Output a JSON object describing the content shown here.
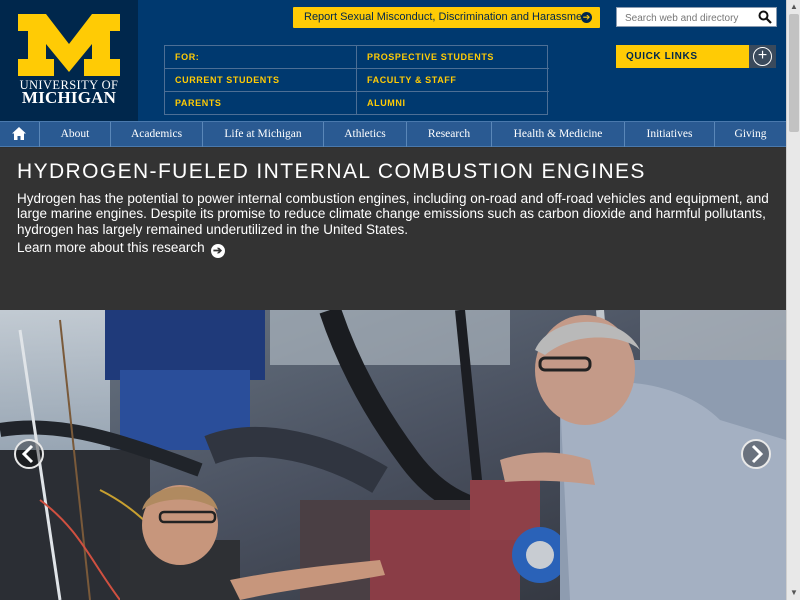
{
  "brand": {
    "line1": "UNIVERSITY OF",
    "line2": "MICHIGAN"
  },
  "alert": {
    "label": "Report Sexual Misconduct, Discrimination and Harassment",
    "icon": "arrow-right-circle-icon"
  },
  "search": {
    "placeholder": "Search web and directory",
    "icon": "search-icon"
  },
  "audiences": {
    "for_label": "FOR:",
    "items": [
      "PROSPECTIVE STUDENTS",
      "CURRENT STUDENTS",
      "FACULTY & STAFF",
      "PARENTS",
      "ALUMNI"
    ]
  },
  "quick_links": {
    "label": "QUICK LINKS",
    "icon": "plus-circle-icon"
  },
  "nav": {
    "home_icon": "home-icon",
    "items": [
      "About",
      "Academics",
      "Life at Michigan",
      "Athletics",
      "Research",
      "Health & Medicine",
      "Initiatives",
      "Giving"
    ]
  },
  "hero": {
    "title": "HYDROGEN-FUELED INTERNAL COMBUSTION ENGINES",
    "description": "Hydrogen has the potential to power internal combustion engines, including on-road and off-road vehicles and equipment, and large marine engines. Despite its promise to reduce climate change emissions such as carbon dioxide and harmful pollutants, hydrogen has largely remained underutilized in the United States.",
    "link": "Learn more about this research"
  },
  "carousel": {
    "prev_icon": "chevron-left-icon",
    "next_icon": "chevron-right-icon"
  },
  "colors": {
    "maize": "#ffcb05",
    "blue": "#00274c",
    "nav_blue": "#2a5a92",
    "hero_bg": "#333333"
  }
}
